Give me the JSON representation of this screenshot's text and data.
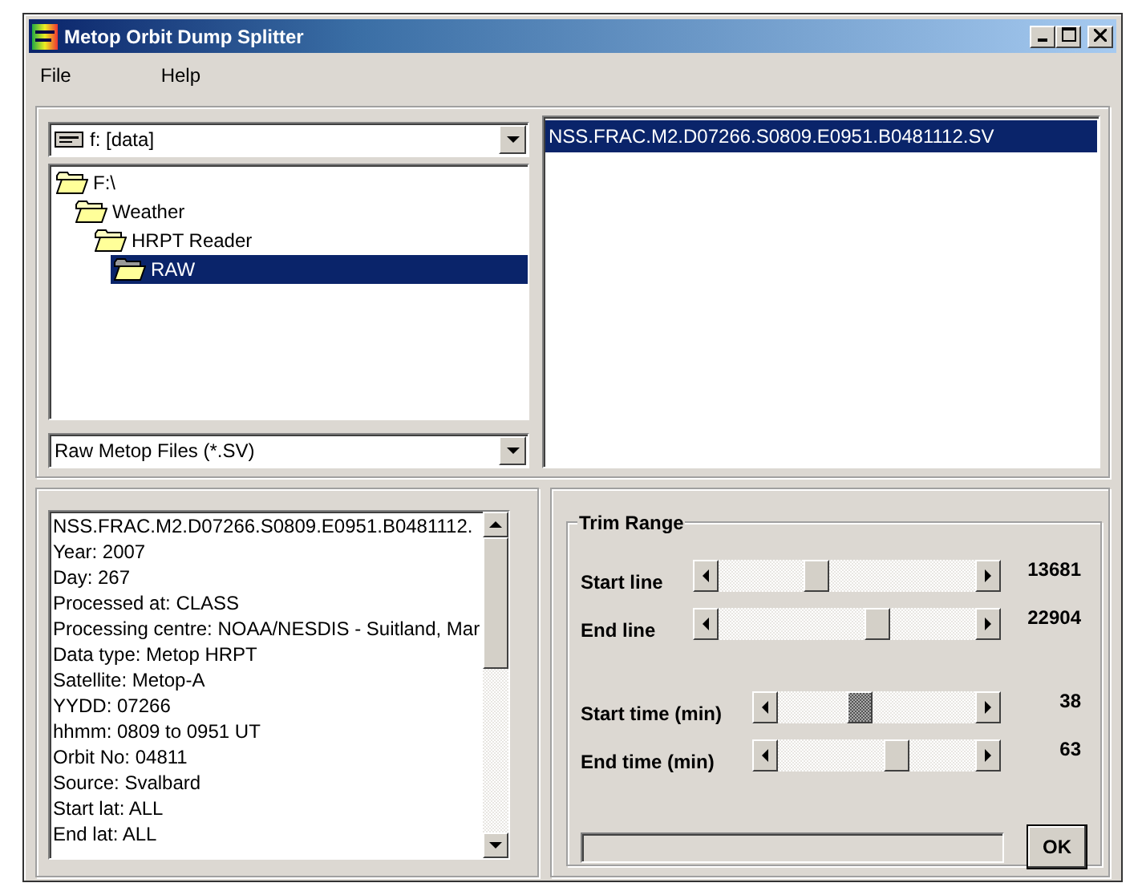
{
  "window": {
    "title": "Metop Orbit Dump Splitter"
  },
  "menu": [
    "File",
    "Help"
  ],
  "drive_select": {
    "value": "f: [data]"
  },
  "folders": [
    {
      "label": "F:\\",
      "selected": false,
      "children": [
        {
          "label": "Weather",
          "selected": false,
          "children": [
            {
              "label": "HRPT Reader",
              "selected": false,
              "children": [
                {
                  "label": "RAW",
                  "selected": true
                }
              ]
            }
          ]
        }
      ]
    }
  ],
  "filter_select": {
    "value": "Raw Metop Files (*.SV)"
  },
  "files": [
    {
      "name": "NSS.FRAC.M2.D07266.S0809.E0951.B0481112.SV",
      "selected": true
    }
  ],
  "info_lines": [
    "NSS.FRAC.M2.D07266.S0809.E0951.B0481112.",
    "Year: 2007",
    "Day: 267",
    "Processed at: CLASS",
    "Processing centre: NOAA/NESDIS - Suitland, Mar",
    "Data type: Metop HRPT",
    "Satellite: Metop-A",
    "YYDD: 07266",
    "hhmm: 0809 to 0951 UT",
    "Orbit No: 04811",
    "Source: Svalbard",
    "Start lat: ALL",
    "End lat: ALL"
  ],
  "trim_range": {
    "title": "Trim Range",
    "sliders": [
      {
        "kind": "line",
        "label": "Start line",
        "level": 0.37,
        "focused": false,
        "reading": "13681"
      },
      {
        "kind": "line",
        "label": "End line",
        "level": 0.63,
        "focused": false,
        "reading": "22904"
      },
      {
        "kind": "time",
        "label": "Start time (min)",
        "level": 0.4,
        "focused": true,
        "reading": "38"
      },
      {
        "kind": "time",
        "label": "End time (min)",
        "level": 0.62,
        "focused": false,
        "reading": "63"
      }
    ],
    "ok_button": "OK"
  }
}
